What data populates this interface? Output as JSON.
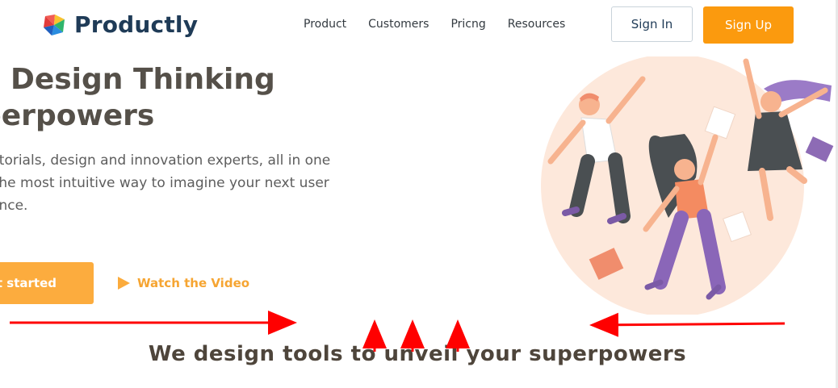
{
  "brand": {
    "name": "Productly"
  },
  "nav": {
    "items": [
      "Product",
      "Customers",
      "Pricng",
      "Resources"
    ]
  },
  "auth": {
    "sign_in": "Sign In",
    "sign_up": "Sign Up"
  },
  "hero": {
    "title_line1": "e Design Thinking",
    "title_line2": "perpowers",
    "desc_line1": "utorials, design and innovation experts, all in one",
    "desc_line2": " The most intuitive way to imagine your next user",
    "desc_line3": "ence.",
    "cta_primary": "et started",
    "cta_secondary": "Watch the Video"
  },
  "tagline": "We design tools to unveil your superpowers",
  "colors": {
    "accent": "#fb9a0e",
    "brand_text": "#1f3b57",
    "annotation": "#ff0000"
  }
}
